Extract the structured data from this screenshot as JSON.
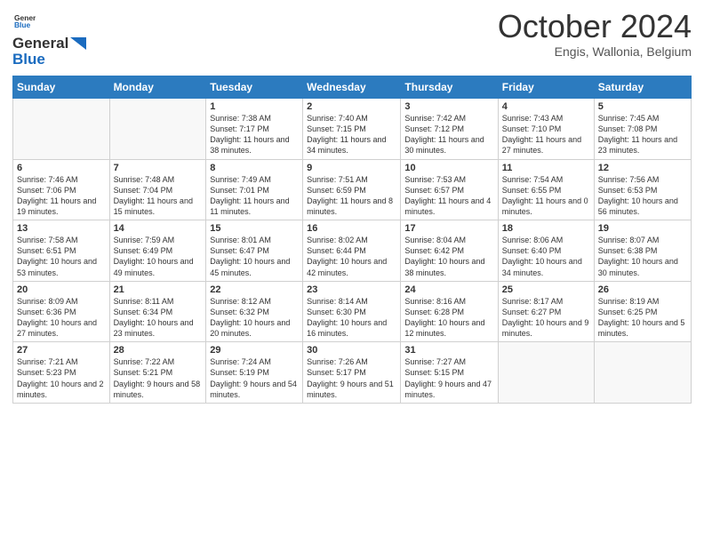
{
  "header": {
    "logo_line1": "General",
    "logo_line2": "Blue",
    "month": "October 2024",
    "location": "Engis, Wallonia, Belgium"
  },
  "weekdays": [
    "Sunday",
    "Monday",
    "Tuesday",
    "Wednesday",
    "Thursday",
    "Friday",
    "Saturday"
  ],
  "weeks": [
    [
      {
        "day": "",
        "sunrise": "",
        "sunset": "",
        "daylight": ""
      },
      {
        "day": "",
        "sunrise": "",
        "sunset": "",
        "daylight": ""
      },
      {
        "day": "1",
        "sunrise": "Sunrise: 7:38 AM",
        "sunset": "Sunset: 7:17 PM",
        "daylight": "Daylight: 11 hours and 38 minutes."
      },
      {
        "day": "2",
        "sunrise": "Sunrise: 7:40 AM",
        "sunset": "Sunset: 7:15 PM",
        "daylight": "Daylight: 11 hours and 34 minutes."
      },
      {
        "day": "3",
        "sunrise": "Sunrise: 7:42 AM",
        "sunset": "Sunset: 7:12 PM",
        "daylight": "Daylight: 11 hours and 30 minutes."
      },
      {
        "day": "4",
        "sunrise": "Sunrise: 7:43 AM",
        "sunset": "Sunset: 7:10 PM",
        "daylight": "Daylight: 11 hours and 27 minutes."
      },
      {
        "day": "5",
        "sunrise": "Sunrise: 7:45 AM",
        "sunset": "Sunset: 7:08 PM",
        "daylight": "Daylight: 11 hours and 23 minutes."
      }
    ],
    [
      {
        "day": "6",
        "sunrise": "Sunrise: 7:46 AM",
        "sunset": "Sunset: 7:06 PM",
        "daylight": "Daylight: 11 hours and 19 minutes."
      },
      {
        "day": "7",
        "sunrise": "Sunrise: 7:48 AM",
        "sunset": "Sunset: 7:04 PM",
        "daylight": "Daylight: 11 hours and 15 minutes."
      },
      {
        "day": "8",
        "sunrise": "Sunrise: 7:49 AM",
        "sunset": "Sunset: 7:01 PM",
        "daylight": "Daylight: 11 hours and 11 minutes."
      },
      {
        "day": "9",
        "sunrise": "Sunrise: 7:51 AM",
        "sunset": "Sunset: 6:59 PM",
        "daylight": "Daylight: 11 hours and 8 minutes."
      },
      {
        "day": "10",
        "sunrise": "Sunrise: 7:53 AM",
        "sunset": "Sunset: 6:57 PM",
        "daylight": "Daylight: 11 hours and 4 minutes."
      },
      {
        "day": "11",
        "sunrise": "Sunrise: 7:54 AM",
        "sunset": "Sunset: 6:55 PM",
        "daylight": "Daylight: 11 hours and 0 minutes."
      },
      {
        "day": "12",
        "sunrise": "Sunrise: 7:56 AM",
        "sunset": "Sunset: 6:53 PM",
        "daylight": "Daylight: 10 hours and 56 minutes."
      }
    ],
    [
      {
        "day": "13",
        "sunrise": "Sunrise: 7:58 AM",
        "sunset": "Sunset: 6:51 PM",
        "daylight": "Daylight: 10 hours and 53 minutes."
      },
      {
        "day": "14",
        "sunrise": "Sunrise: 7:59 AM",
        "sunset": "Sunset: 6:49 PM",
        "daylight": "Daylight: 10 hours and 49 minutes."
      },
      {
        "day": "15",
        "sunrise": "Sunrise: 8:01 AM",
        "sunset": "Sunset: 6:47 PM",
        "daylight": "Daylight: 10 hours and 45 minutes."
      },
      {
        "day": "16",
        "sunrise": "Sunrise: 8:02 AM",
        "sunset": "Sunset: 6:44 PM",
        "daylight": "Daylight: 10 hours and 42 minutes."
      },
      {
        "day": "17",
        "sunrise": "Sunrise: 8:04 AM",
        "sunset": "Sunset: 6:42 PM",
        "daylight": "Daylight: 10 hours and 38 minutes."
      },
      {
        "day": "18",
        "sunrise": "Sunrise: 8:06 AM",
        "sunset": "Sunset: 6:40 PM",
        "daylight": "Daylight: 10 hours and 34 minutes."
      },
      {
        "day": "19",
        "sunrise": "Sunrise: 8:07 AM",
        "sunset": "Sunset: 6:38 PM",
        "daylight": "Daylight: 10 hours and 30 minutes."
      }
    ],
    [
      {
        "day": "20",
        "sunrise": "Sunrise: 8:09 AM",
        "sunset": "Sunset: 6:36 PM",
        "daylight": "Daylight: 10 hours and 27 minutes."
      },
      {
        "day": "21",
        "sunrise": "Sunrise: 8:11 AM",
        "sunset": "Sunset: 6:34 PM",
        "daylight": "Daylight: 10 hours and 23 minutes."
      },
      {
        "day": "22",
        "sunrise": "Sunrise: 8:12 AM",
        "sunset": "Sunset: 6:32 PM",
        "daylight": "Daylight: 10 hours and 20 minutes."
      },
      {
        "day": "23",
        "sunrise": "Sunrise: 8:14 AM",
        "sunset": "Sunset: 6:30 PM",
        "daylight": "Daylight: 10 hours and 16 minutes."
      },
      {
        "day": "24",
        "sunrise": "Sunrise: 8:16 AM",
        "sunset": "Sunset: 6:28 PM",
        "daylight": "Daylight: 10 hours and 12 minutes."
      },
      {
        "day": "25",
        "sunrise": "Sunrise: 8:17 AM",
        "sunset": "Sunset: 6:27 PM",
        "daylight": "Daylight: 10 hours and 9 minutes."
      },
      {
        "day": "26",
        "sunrise": "Sunrise: 8:19 AM",
        "sunset": "Sunset: 6:25 PM",
        "daylight": "Daylight: 10 hours and 5 minutes."
      }
    ],
    [
      {
        "day": "27",
        "sunrise": "Sunrise: 7:21 AM",
        "sunset": "Sunset: 5:23 PM",
        "daylight": "Daylight: 10 hours and 2 minutes."
      },
      {
        "day": "28",
        "sunrise": "Sunrise: 7:22 AM",
        "sunset": "Sunset: 5:21 PM",
        "daylight": "Daylight: 9 hours and 58 minutes."
      },
      {
        "day": "29",
        "sunrise": "Sunrise: 7:24 AM",
        "sunset": "Sunset: 5:19 PM",
        "daylight": "Daylight: 9 hours and 54 minutes."
      },
      {
        "day": "30",
        "sunrise": "Sunrise: 7:26 AM",
        "sunset": "Sunset: 5:17 PM",
        "daylight": "Daylight: 9 hours and 51 minutes."
      },
      {
        "day": "31",
        "sunrise": "Sunrise: 7:27 AM",
        "sunset": "Sunset: 5:15 PM",
        "daylight": "Daylight: 9 hours and 47 minutes."
      },
      {
        "day": "",
        "sunrise": "",
        "sunset": "",
        "daylight": ""
      },
      {
        "day": "",
        "sunrise": "",
        "sunset": "",
        "daylight": ""
      }
    ]
  ]
}
